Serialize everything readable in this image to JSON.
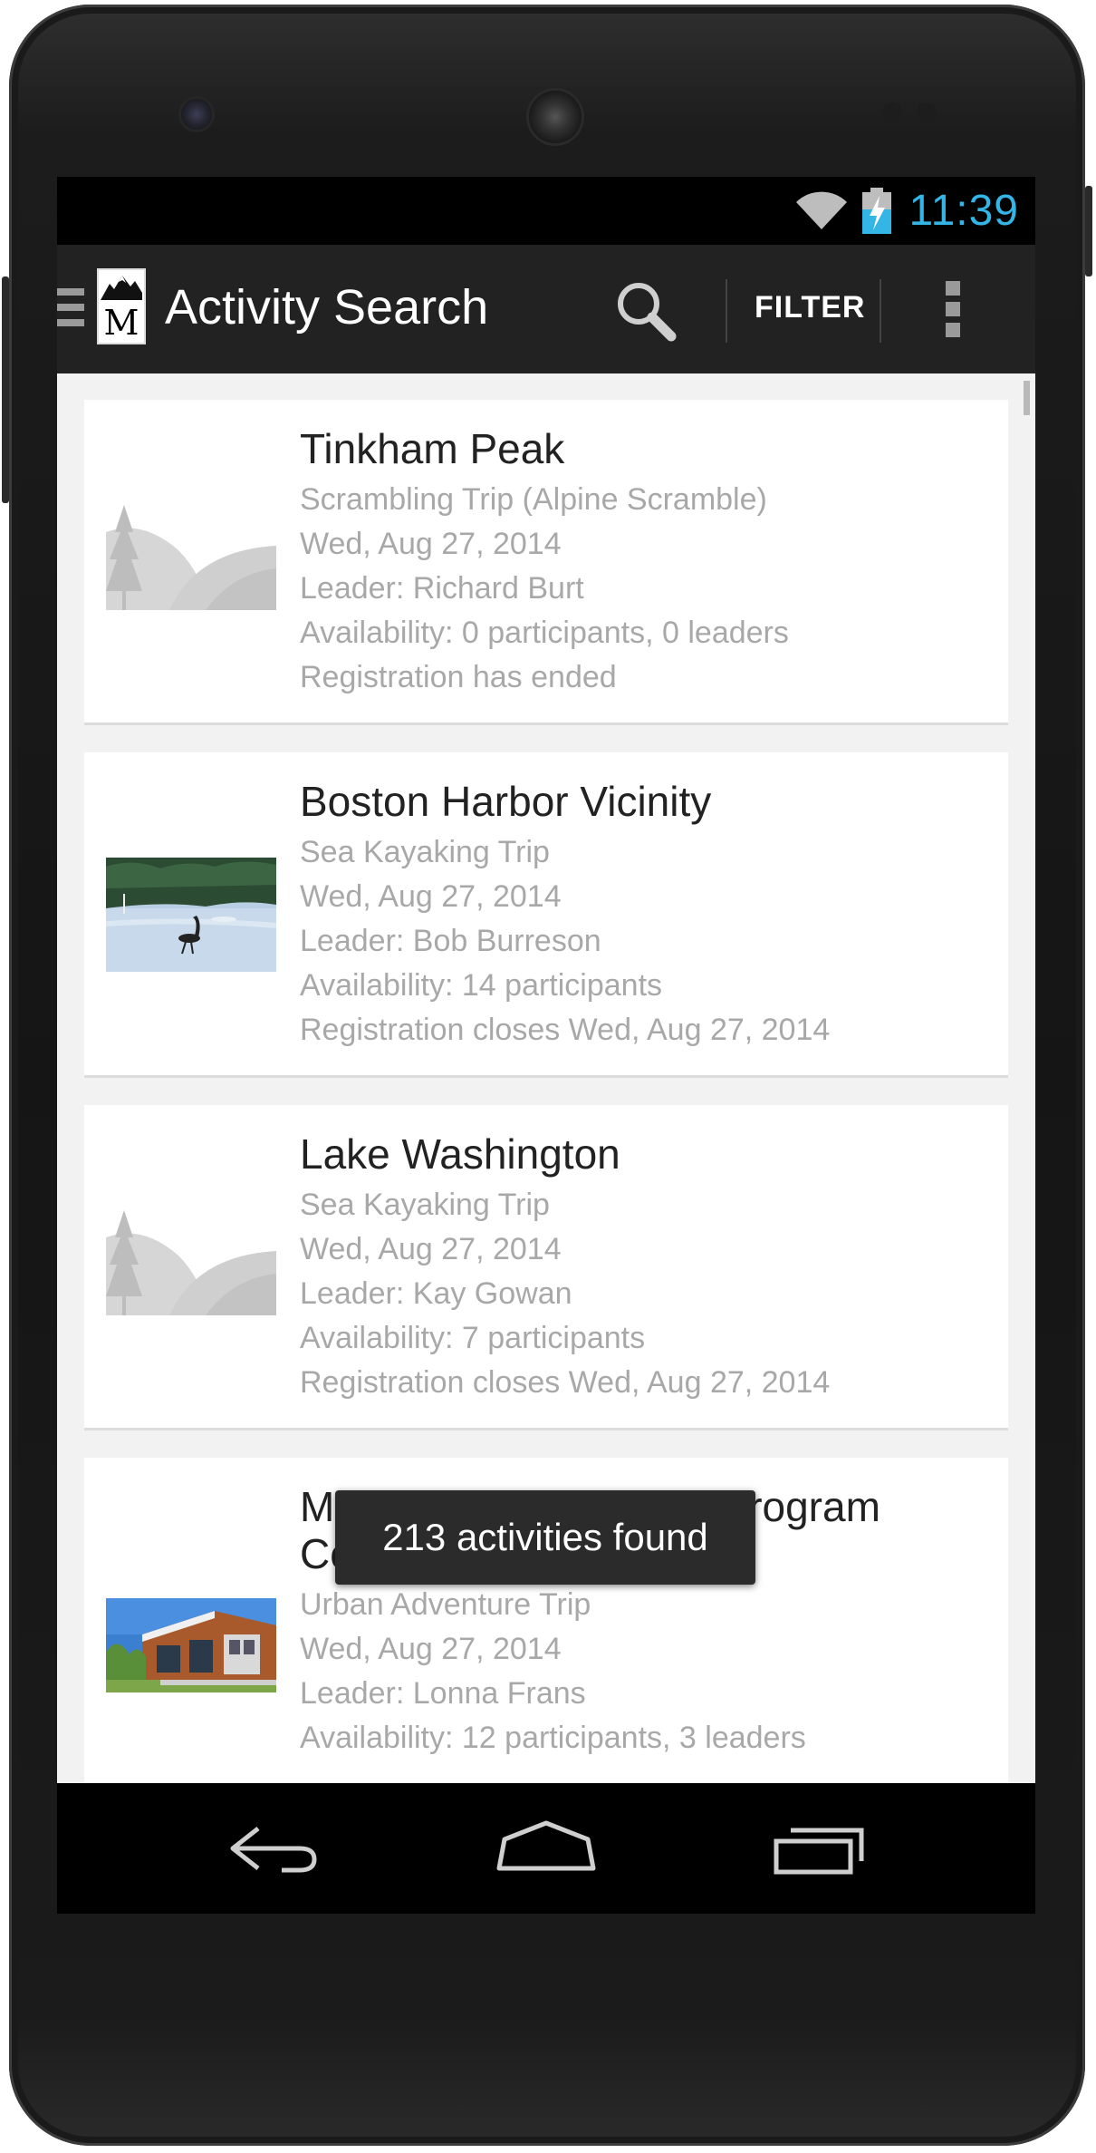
{
  "status_bar": {
    "time": "11:39",
    "wifi_icon": "wifi-icon",
    "battery_icon": "battery-charging-icon",
    "time_color": "#33b5e5"
  },
  "action_bar": {
    "title": "Activity Search",
    "logo_letter": "M",
    "drawer_icon": "menu-drawer-icon",
    "search_icon": "search-icon",
    "filter_label": "FILTER",
    "overflow_icon": "overflow-menu-icon"
  },
  "activities": [
    {
      "title": "Tinkham Peak",
      "type": "Scrambling Trip (Alpine Scramble)",
      "date": "Wed, Aug 27, 2014",
      "leader": "Leader: Richard Burt",
      "availability": "Availability: 0 participants, 0 leaders",
      "registration": "Registration has ended",
      "image": "placeholder-landscape"
    },
    {
      "title": "Boston Harbor Vicinity",
      "type": "Sea Kayaking Trip",
      "date": "Wed, Aug 27, 2014",
      "leader": "Leader: Bob Burreson",
      "availability": "Availability: 14 participants",
      "registration": "Registration closes Wed, Aug 27, 2014",
      "image": "heron-photo"
    },
    {
      "title": "Lake Washington",
      "type": "Sea Kayaking Trip",
      "date": "Wed, Aug 27, 2014",
      "leader": "Leader: Kay Gowan",
      "availability": "Availability: 7 participants",
      "registration": "Registration closes Wed, Aug 27, 2014",
      "image": "placeholder-landscape"
    },
    {
      "title": "Mountaineers Tacoma Program Center",
      "type": "Urban Adventure Trip",
      "date": "Wed, Aug 27, 2014",
      "leader": "Leader: Lonna Frans",
      "availability": "Availability: 12 participants, 3 leaders",
      "image": "building-photo"
    }
  ],
  "toast": {
    "message": "213 activities found"
  },
  "nav_bar": {
    "back_icon": "back-icon",
    "home_icon": "home-icon",
    "recents_icon": "recent-apps-icon"
  }
}
